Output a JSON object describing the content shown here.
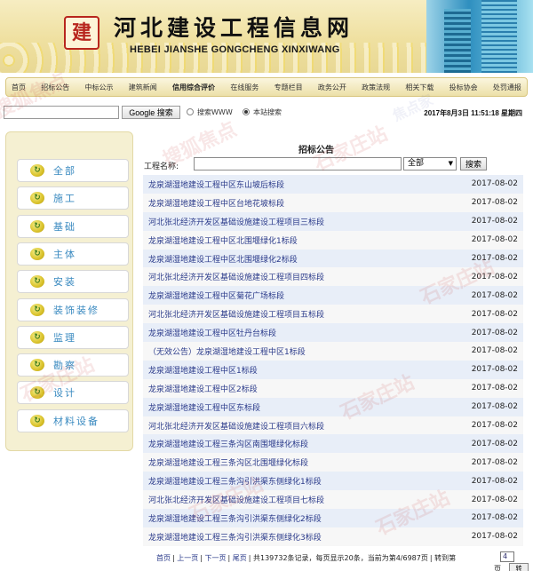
{
  "site": {
    "logo_text": "建",
    "title": "河北建设工程信息网",
    "subtitle": "HEBEI JIANSHE GONGCHENG XINXIWANG"
  },
  "nav": [
    {
      "label": "首页",
      "active": false
    },
    {
      "label": "招标公告",
      "active": false
    },
    {
      "label": "中标公示",
      "active": false
    },
    {
      "label": "建筑新闻",
      "active": false
    },
    {
      "label": "信用综合评价",
      "active": true
    },
    {
      "label": "在线服务",
      "active": false
    },
    {
      "label": "专题栏目",
      "active": false
    },
    {
      "label": "政务公开",
      "active": false
    },
    {
      "label": "政策法规",
      "active": false
    },
    {
      "label": "相关下载",
      "active": false
    },
    {
      "label": "投标协会",
      "active": false
    },
    {
      "label": "处罚通报",
      "active": false
    }
  ],
  "search": {
    "google_button": "Google 搜索",
    "option_www": "搜索WWW",
    "option_site": "本站搜索",
    "selected": "site",
    "datetime": "2017年8月3日 11:51:18 星期四"
  },
  "sidebar": {
    "items": [
      {
        "label": "全部"
      },
      {
        "label": "施工"
      },
      {
        "label": "基础"
      },
      {
        "label": "主体"
      },
      {
        "label": "安装"
      },
      {
        "label": "装饰装修"
      },
      {
        "label": "监理"
      },
      {
        "label": "勘察"
      },
      {
        "label": "设计"
      },
      {
        "label": "材料设备"
      }
    ]
  },
  "main": {
    "title": "招标公告",
    "filter_label": "工程名称:",
    "filter_value": "",
    "select_value": "全部",
    "search_button": "搜索"
  },
  "notices": [
    {
      "title": "龙泉湖湿地建设工程中区东山坡后标段",
      "date": "2017-08-02"
    },
    {
      "title": "龙泉湖湿地建设工程中区台地花坡标段",
      "date": "2017-08-02"
    },
    {
      "title": "河北张北经济开发区基础设施建设工程项目三标段",
      "date": "2017-08-02"
    },
    {
      "title": "龙泉湖湿地建设工程中区北围堰绿化1标段",
      "date": "2017-08-02"
    },
    {
      "title": "龙泉湖湿地建设工程中区北围堰绿化2标段",
      "date": "2017-08-02"
    },
    {
      "title": "河北张北经济开发区基础设施建设工程项目四标段",
      "date": "2017-08-02"
    },
    {
      "title": "龙泉湖湿地建设工程中区菊花广场标段",
      "date": "2017-08-02"
    },
    {
      "title": "河北张北经济开发区基础设施建设工程项目五标段",
      "date": "2017-08-02"
    },
    {
      "title": "龙泉湖湿地建设工程中区牡丹台标段",
      "date": "2017-08-02"
    },
    {
      "title": "（无效公告）龙泉湖湿地建设工程中区1标段",
      "date": "2017-08-02"
    },
    {
      "title": "龙泉湖湿地建设工程中区1标段",
      "date": "2017-08-02"
    },
    {
      "title": "龙泉湖湿地建设工程中区2标段",
      "date": "2017-08-02"
    },
    {
      "title": "龙泉湖湿地建设工程中区东标段",
      "date": "2017-08-02"
    },
    {
      "title": "河北张北经济开发区基础设施建设工程项目六标段",
      "date": "2017-08-02"
    },
    {
      "title": "龙泉湖湿地建设工程三条沟区南围堰绿化标段",
      "date": "2017-08-02"
    },
    {
      "title": "龙泉湖湿地建设工程三条沟区北围堰绿化标段",
      "date": "2017-08-02"
    },
    {
      "title": "龙泉湖湿地建设工程三条沟引洪渠东侧绿化1标段",
      "date": "2017-08-02"
    },
    {
      "title": "河北张北经济开发区基础设施建设工程项目七标段",
      "date": "2017-08-02"
    },
    {
      "title": "龙泉湖湿地建设工程三条沟引洪渠东侧绿化2标段",
      "date": "2017-08-02"
    },
    {
      "title": "龙泉湖湿地建设工程三条沟引洪渠东侧绿化3标段",
      "date": "2017-08-02"
    }
  ],
  "pager": {
    "first": "首页",
    "prev": "上一页",
    "next": "下一页",
    "last": "尾页",
    "summary": "共139732条记录，每页显示20条，当前为第4/6987页",
    "goto_label": "转到第",
    "goto_value": "4",
    "goto_tail": "页",
    "go_button": "转"
  },
  "watermarks": [
    "搜狐焦点",
    "搜狐焦点",
    "焦点家",
    "石家庄站",
    "石家庄站",
    "石家庄站",
    "石家庄站",
    "石家庄站",
    "石家庄站"
  ]
}
